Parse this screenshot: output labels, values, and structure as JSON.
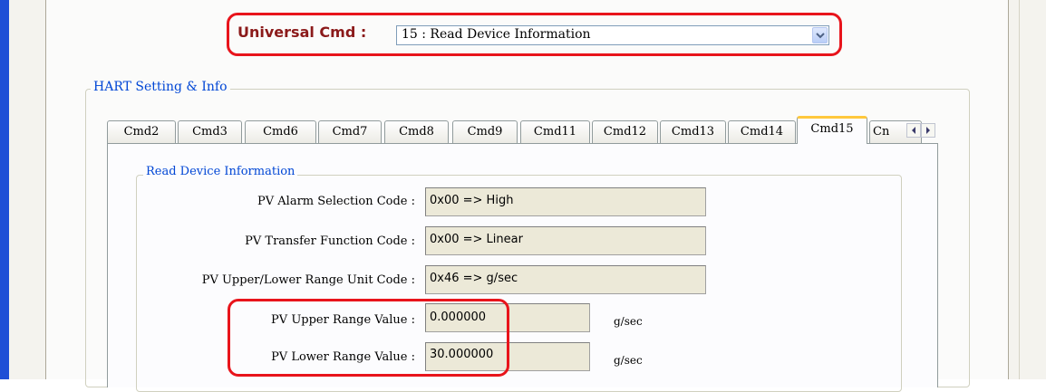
{
  "universal_cmd": {
    "label": "Universal Cmd :",
    "selected": "15 : Read Device Information"
  },
  "hart_group": {
    "title": "HART Setting & Info"
  },
  "tabs": [
    {
      "label": "Cmd2"
    },
    {
      "label": "Cmd3"
    },
    {
      "label": "Cmd6"
    },
    {
      "label": "Cmd7"
    },
    {
      "label": "Cmd8"
    },
    {
      "label": "Cmd9"
    },
    {
      "label": "Cmd11"
    },
    {
      "label": "Cmd12"
    },
    {
      "label": "Cmd13"
    },
    {
      "label": "Cmd14"
    },
    {
      "label": "Cmd15",
      "active": true
    },
    {
      "label": "Cn"
    }
  ],
  "read_device_info": {
    "title": "Read Device Information",
    "fields": [
      {
        "label": "PV Alarm Selection Code :",
        "value": "0x00 => High"
      },
      {
        "label": "PV Transfer Function Code :",
        "value": "0x00 => Linear"
      },
      {
        "label": "PV Upper/Lower Range Unit Code :",
        "value": "0x46 => g/sec"
      },
      {
        "label": "PV Upper Range Value :",
        "value": "0.000000",
        "unit": "g/sec"
      },
      {
        "label": "PV Lower Range Value :",
        "value": "30.000000",
        "unit": "g/sec"
      }
    ]
  },
  "colors": {
    "highlight": "#e8141b",
    "group_title": "#0046d5",
    "active_tab_accent": "#ffc83c"
  }
}
